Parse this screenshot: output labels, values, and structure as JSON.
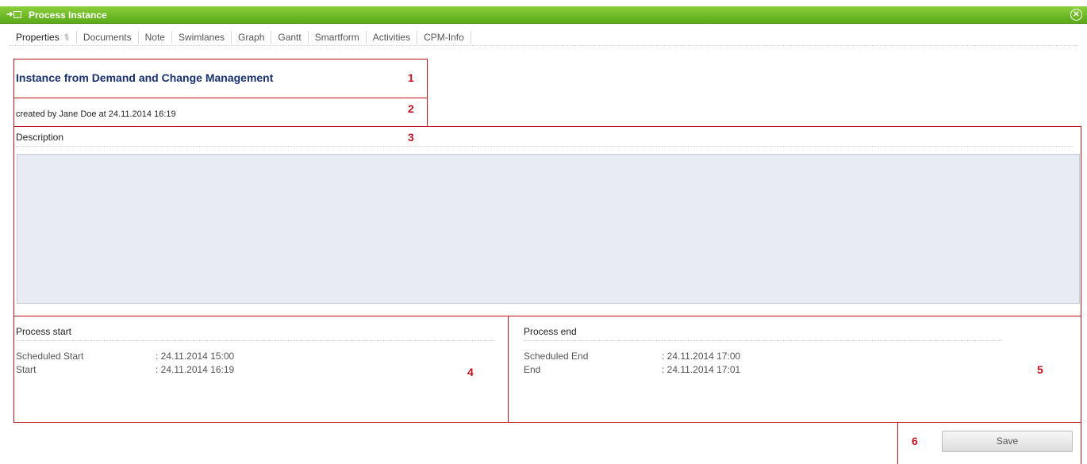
{
  "window": {
    "title": "Process Instance"
  },
  "tabs": [
    {
      "label": "Properties",
      "active": true
    },
    {
      "label": "Documents"
    },
    {
      "label": "Note"
    },
    {
      "label": "Swimlanes"
    },
    {
      "label": "Graph"
    },
    {
      "label": "Gantt"
    },
    {
      "label": "Smartform"
    },
    {
      "label": "Activities"
    },
    {
      "label": "CPM-Info"
    }
  ],
  "properties": {
    "title": "Instance from Demand and Change Management",
    "created": "created by Jane Doe at 24.11.2014 16:19",
    "description_label": "Description",
    "description_value": ""
  },
  "process_start": {
    "heading": "Process start",
    "scheduled_label": "Scheduled Start",
    "scheduled_value": ": 24.11.2014 15:00",
    "actual_label": "Start",
    "actual_value": ": 24.11.2014 16:19"
  },
  "process_end": {
    "heading": "Process end",
    "scheduled_label": "Scheduled End",
    "scheduled_value": ": 24.11.2014 17:00",
    "actual_label": "End",
    "actual_value": ": 24.11.2014 17:01"
  },
  "annotations": [
    "1",
    "2",
    "3",
    "4",
    "5",
    "6"
  ],
  "actions": {
    "save_label": "Save"
  },
  "colors": {
    "titlebar": "#6cb826",
    "annotation": "#c1121f",
    "description_bg": "#e8ebf3",
    "title_text": "#18306b"
  }
}
